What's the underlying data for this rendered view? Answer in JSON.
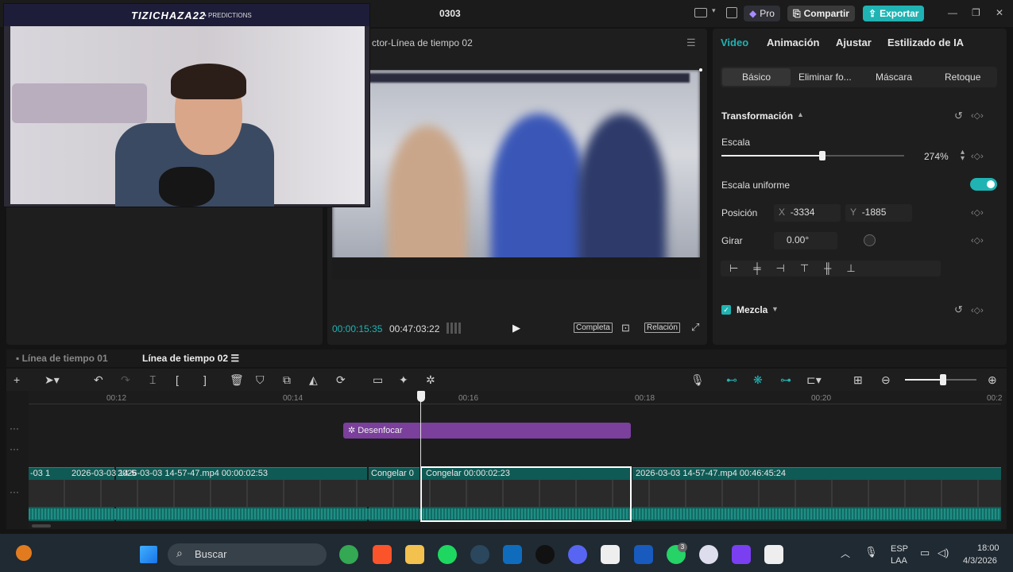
{
  "window": {
    "title": "0303",
    "pro_label": "Pro",
    "share_label": "Compartir",
    "export_label": "Exportar",
    "min": "—",
    "max": "❐",
    "close": "✕"
  },
  "webcam": {
    "name": "TIZICHAZA22",
    "tag": "• PREDICTIONS"
  },
  "viewer": {
    "title": "ctor-Línea de tiempo 02",
    "current_time": "00:00:15:35",
    "total_time": "00:47:03:22",
    "full_label": "Completa",
    "ratio_label": "Relación"
  },
  "inspector": {
    "tabs": [
      "Video",
      "Animación",
      "Ajustar",
      "Estilizado de IA"
    ],
    "subtabs": [
      "Básico",
      "Eliminar fo...",
      "Máscara",
      "Retoque"
    ],
    "transform_label": "Transformación",
    "scale_label": "Escala",
    "scale_value": "274%",
    "scale_fraction": 0.55,
    "uniform_label": "Escala uniforme",
    "position_label": "Posición",
    "x_label": "X",
    "x_value": "-3334",
    "y_label": "Y",
    "y_value": "-1885",
    "rotate_label": "Girar",
    "rotate_value": "0.00°",
    "blend_label": "Mezcla"
  },
  "timeline": {
    "tabs": [
      "Línea de tiempo 01",
      "Línea de tiempo 02"
    ],
    "ticks": [
      "00:12",
      "00:14",
      "00:16",
      "00:18",
      "00:20",
      "00:2"
    ],
    "effect_label": "Desenfocar",
    "clips": [
      {
        "label": "-03 1"
      },
      {
        "label": "2026-03-03 14-5"
      },
      {
        "label": "2026-03-03 14-57-47.mp4  00:00:02:53"
      },
      {
        "label": "Congelar  0"
      },
      {
        "label": "Congelar  00:00:02:23"
      },
      {
        "label": "2026-03-03 14-57-47.mp4  00:46:45:24"
      }
    ]
  },
  "taskbar": {
    "search_label": "Buscar",
    "lang1": "ESP",
    "lang2": "LAA",
    "time": "18:00",
    "date": "4/3/2026",
    "whatsapp_badge": "3"
  },
  "colors": {
    "accent": "#20b3b3",
    "clip": "#0f5a55",
    "effect": "#7b3f9c"
  }
}
